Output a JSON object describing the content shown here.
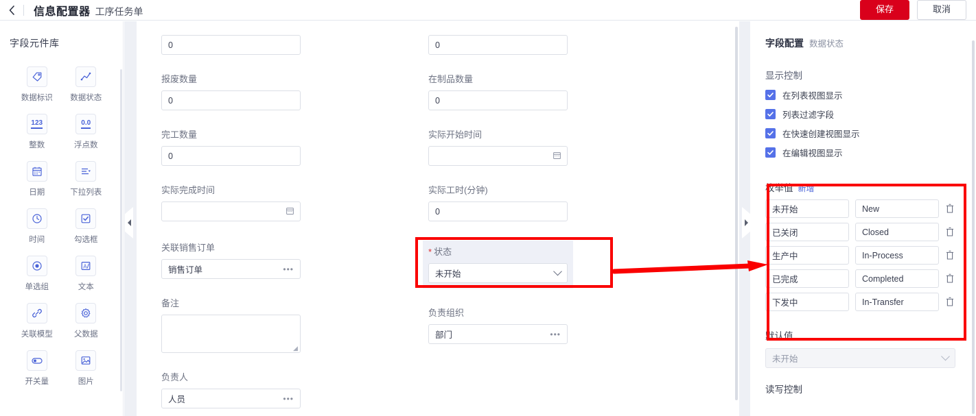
{
  "header": {
    "back_icon": "chevron-left-icon",
    "title": "信息配置器",
    "subtitle": "工序任务单",
    "save_label": "保存",
    "cancel_label": "取消"
  },
  "sidebar": {
    "title": "字段元件库",
    "items": [
      {
        "label": "数据标识",
        "icon": "tag-icon"
      },
      {
        "label": "数据状态",
        "icon": "line-chart-icon"
      },
      {
        "label": "整数",
        "icon": "integer-123-icon"
      },
      {
        "label": "浮点数",
        "icon": "float-00-icon"
      },
      {
        "label": "日期",
        "icon": "calendar-icon"
      },
      {
        "label": "下拉列表",
        "icon": "dropdown-list-icon"
      },
      {
        "label": "时间",
        "icon": "clock-icon"
      },
      {
        "label": "勾选框",
        "icon": "checkbox-icon"
      },
      {
        "label": "单选组",
        "icon": "radio-group-icon"
      },
      {
        "label": "文本",
        "icon": "text-icon"
      },
      {
        "label": "关联模型",
        "icon": "link-icon"
      },
      {
        "label": "父数据",
        "icon": "gear-icon"
      },
      {
        "label": "开关量",
        "icon": "toggle-icon"
      },
      {
        "label": "图片",
        "icon": "image-icon"
      }
    ]
  },
  "canvas": {
    "left_column": [
      {
        "label": "",
        "value": "0",
        "type": "number"
      },
      {
        "label": "报废数量",
        "value": "0",
        "type": "number"
      },
      {
        "label": "完工数量",
        "value": "0",
        "type": "number"
      },
      {
        "label": "实际完成时间",
        "value": "",
        "type": "date"
      },
      {
        "label": "关联销售订单",
        "value": "销售订单",
        "type": "lookup"
      },
      {
        "label": "备注",
        "value": "",
        "type": "textarea"
      },
      {
        "label": "负责人",
        "value": "人员",
        "type": "lookup"
      }
    ],
    "right_column": [
      {
        "label": "",
        "value": "0",
        "type": "number"
      },
      {
        "label": "在制品数量",
        "value": "0",
        "type": "number"
      },
      {
        "label": "实际开始时间",
        "value": "",
        "type": "date"
      },
      {
        "label": "实际工时(分钟)",
        "value": "0",
        "type": "number"
      },
      {
        "label": "状态",
        "value": "未开始",
        "type": "select",
        "required": true,
        "selected": true
      },
      {
        "label": "负责组织",
        "value": "部门",
        "type": "lookup"
      }
    ]
  },
  "panel": {
    "title": "字段配置",
    "subtitle": "数据状态",
    "display_control": {
      "section_label": "显示控制",
      "options": [
        {
          "label": "在列表视图显示",
          "checked": true
        },
        {
          "label": "列表过滤字段",
          "checked": true
        },
        {
          "label": "在快速创建视图显示",
          "checked": true
        },
        {
          "label": "在编辑视图显示",
          "checked": true
        }
      ]
    },
    "enum": {
      "section_label": "枚举值",
      "add_label": "新增",
      "rows": [
        {
          "name": "未开始",
          "code": "New"
        },
        {
          "name": "已关闭",
          "code": "Closed"
        },
        {
          "name": "生产中",
          "code": "In-Process"
        },
        {
          "name": "已完成",
          "code": "Completed"
        },
        {
          "name": "下发中",
          "code": "In-Transfer"
        }
      ]
    },
    "default_value": {
      "label": "默认值",
      "value": "未开始"
    },
    "read_write_control": {
      "label": "读写控制"
    }
  },
  "colors": {
    "accent_blue": "#4a63d8",
    "checkbox_blue": "#5571e8",
    "save_red": "#d9001b",
    "annotation_red": "#fa0000",
    "selected_field_bg": "#eef0f7"
  }
}
